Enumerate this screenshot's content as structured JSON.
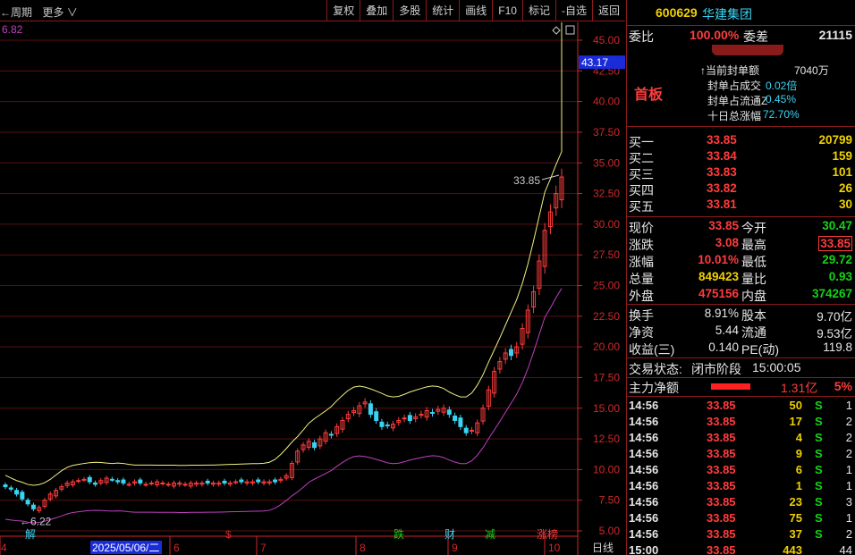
{
  "toolbar": {
    "period_label": "←周期",
    "more_label": "更多 ∨",
    "buttons": [
      "复权",
      "叠加",
      "多股",
      "统计",
      "画线",
      "F10",
      "标记",
      "-自选",
      "返回"
    ]
  },
  "chart": {
    "top_left_value": "6.82",
    "current_price_tag": "43.17",
    "high_label": "33.85",
    "low_label": "←6.22",
    "date_highlight": "2025/05/06/二",
    "period_label": "日线",
    "y_ticks": [
      "45.00",
      "42.50",
      "40.00",
      "37.50",
      "35.00",
      "32.50",
      "30.00",
      "27.50",
      "25.00",
      "22.50",
      "20.00",
      "17.50",
      "15.00",
      "12.50",
      "10.00",
      "7.50",
      "5.00"
    ],
    "x_labels": [
      {
        "text": "4",
        "color": "#d02828"
      },
      {
        "text": "6",
        "color": "#d02828"
      },
      {
        "text": "7",
        "color": "#d02828"
      },
      {
        "text": "8",
        "color": "#d02828"
      },
      {
        "text": "9",
        "color": "#d02828"
      },
      {
        "text": "10",
        "color": "#d02828"
      }
    ],
    "markers": [
      {
        "text": "解",
        "color": "#3ad3f2"
      },
      {
        "text": "$",
        "color": "#d02828"
      },
      {
        "text": "跌",
        "color": "#16d216"
      },
      {
        "text": "财",
        "color": "#3ad3f2"
      },
      {
        "text": "减",
        "color": "#16d216"
      },
      {
        "text": "涨榜",
        "color": "#ff3c3c"
      }
    ],
    "colors": {
      "up": "#ff3c3c",
      "down": "#3ad3f2",
      "upper_band": "#f0f080",
      "lower_band": "#c040c0",
      "grid": "#5a1010",
      "axis": "#d02828"
    }
  },
  "chart_data": {
    "type": "candlestick",
    "ylim": [
      5.0,
      45.0
    ],
    "y_ticks": [
      5.0,
      7.5,
      10.0,
      12.5,
      15.0,
      17.5,
      20.0,
      22.5,
      25.0,
      27.5,
      30.0,
      32.5,
      35.0,
      37.5,
      40.0,
      42.5,
      45.0
    ],
    "x_tick_labels": [
      "4",
      "6",
      "7",
      "8",
      "9",
      "10"
    ],
    "highest_marked": 33.85,
    "lowest_marked": 6.22,
    "current_price": 43.17,
    "closes": [
      8.6,
      8.4,
      8.0,
      7.6,
      7.2,
      6.8,
      6.9,
      7.5,
      8.0,
      8.3,
      8.6,
      8.9,
      9.0,
      9.1,
      9.2,
      9.0,
      8.8,
      9.1,
      9.3,
      9.2,
      9.0,
      8.9,
      8.8,
      9.0,
      8.9,
      8.8,
      8.9,
      9.0,
      8.9,
      8.8,
      8.9,
      8.9,
      8.8,
      8.9,
      8.9,
      8.9,
      8.9,
      8.9,
      8.9,
      8.9,
      8.9,
      9.0,
      9.0,
      9.0,
      9.0,
      9.0,
      9.0,
      9.0,
      9.0,
      9.2,
      9.5,
      10.5,
      11.5,
      12.0,
      12.3,
      11.8,
      12.5,
      13.0,
      12.8,
      13.5,
      14.0,
      14.5,
      14.8,
      15.2,
      15.5,
      14.5,
      14.0,
      13.5,
      13.6,
      13.7,
      14.0,
      14.2,
      14.0,
      14.3,
      14.5,
      14.8,
      14.6,
      14.9,
      15.0,
      14.5,
      14.0,
      13.5,
      13.0,
      13.2,
      13.8,
      15.0,
      16.5,
      18.0,
      18.8,
      19.5,
      19.3,
      20.0,
      21.5,
      23.0,
      24.5,
      27.0,
      29.5,
      31.0,
      32.5,
      33.85
    ]
  },
  "panel": {
    "header": {
      "code": "600629",
      "name": "华建集团"
    },
    "weibi": {
      "label": "委比",
      "value": "100.00%",
      "cha_label": "委差",
      "cha_value": "21115"
    },
    "board": {
      "title": "首板"
    },
    "stats": [
      {
        "label": "↑当前封单额",
        "value": "7040万"
      },
      {
        "label": "封单占成交",
        "value": "0.02倍"
      },
      {
        "label": "封单占流通Z",
        "value": "0.45%"
      },
      {
        "label": "十日总涨幅",
        "value": "72.70%"
      }
    ],
    "bids": [
      {
        "label": "买一",
        "price": "33.85",
        "vol": "20799"
      },
      {
        "label": "买二",
        "price": "33.84",
        "vol": "159"
      },
      {
        "label": "买三",
        "price": "33.83",
        "vol": "101"
      },
      {
        "label": "买四",
        "price": "33.82",
        "vol": "26"
      },
      {
        "label": "买五",
        "price": "33.81",
        "vol": "30"
      }
    ],
    "quote": [
      {
        "l1": "现价",
        "v1": "33.85",
        "c1": "red",
        "l2": "今开",
        "v2": "30.47",
        "c2": "green"
      },
      {
        "l1": "涨跌",
        "v1": "3.08",
        "c1": "red",
        "l2": "最高",
        "v2": "33.85",
        "c2": "red"
      },
      {
        "l1": "涨幅",
        "v1": "10.01%",
        "c1": "red",
        "l2": "最低",
        "v2": "29.72",
        "c2": "green"
      },
      {
        "l1": "总量",
        "v1": "849423",
        "c1": "yellow",
        "l2": "量比",
        "v2": "0.93",
        "c2": "green"
      },
      {
        "l1": "外盘",
        "v1": "475156",
        "c1": "red",
        "l2": "内盘",
        "v2": "374267",
        "c2": "green"
      }
    ],
    "fin": [
      {
        "l1": "换手",
        "v1": "8.91%",
        "l2": "股本",
        "v2": "9.70亿"
      },
      {
        "l1": "净资",
        "v1": "5.44",
        "l2": "流通",
        "v2": "9.53亿"
      },
      {
        "l1": "收益(三)",
        "v1": "0.140",
        "l2": "PE(动)",
        "v2": "119.8"
      }
    ],
    "status": {
      "label": "交易状态:",
      "value": "闭市阶段",
      "time": "15:00:05"
    },
    "net": {
      "label": "主力净额",
      "value": "1.31亿",
      "pct": "5%"
    },
    "ticks": [
      {
        "time": "14:56",
        "price": "33.85",
        "vol": "50",
        "side": "S",
        "n": "1"
      },
      {
        "time": "14:56",
        "price": "33.85",
        "vol": "17",
        "side": "S",
        "n": "2"
      },
      {
        "time": "14:56",
        "price": "33.85",
        "vol": "4",
        "side": "S",
        "n": "2"
      },
      {
        "time": "14:56",
        "price": "33.85",
        "vol": "9",
        "side": "S",
        "n": "2"
      },
      {
        "time": "14:56",
        "price": "33.85",
        "vol": "6",
        "side": "S",
        "n": "1"
      },
      {
        "time": "14:56",
        "price": "33.85",
        "vol": "1",
        "side": "S",
        "n": "1"
      },
      {
        "time": "14:56",
        "price": "33.85",
        "vol": "23",
        "side": "S",
        "n": "3"
      },
      {
        "time": "14:56",
        "price": "33.85",
        "vol": "75",
        "side": "S",
        "n": "1"
      },
      {
        "time": "14:56",
        "price": "33.85",
        "vol": "37",
        "side": "S",
        "n": "2"
      },
      {
        "time": "15:00",
        "price": "33.85",
        "vol": "443",
        "side": "",
        "n": "44"
      }
    ]
  }
}
